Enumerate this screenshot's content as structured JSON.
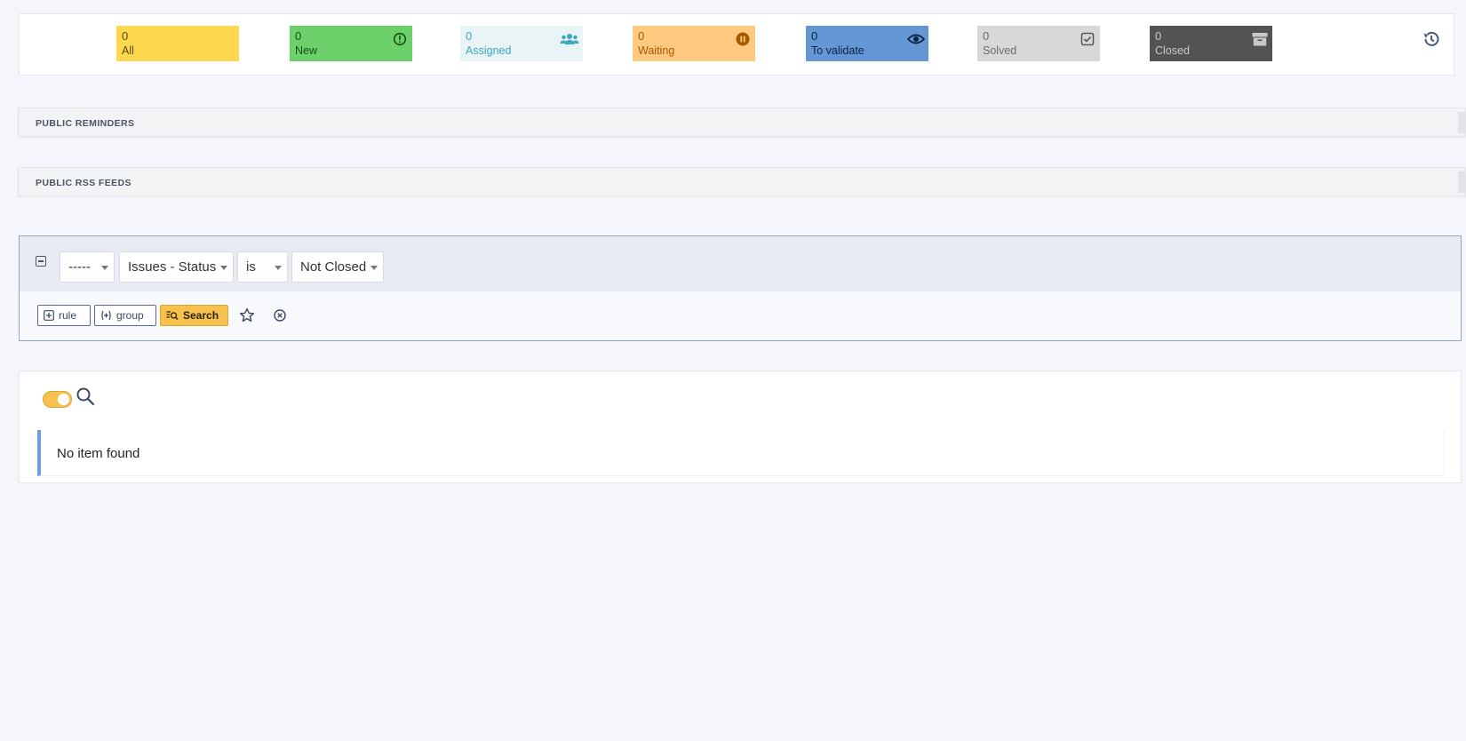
{
  "status_tiles": [
    {
      "key": "all",
      "count": "0",
      "label": "All",
      "icon": "none"
    },
    {
      "key": "new",
      "count": "0",
      "label": "New",
      "icon": "exclamation-circle-icon"
    },
    {
      "key": "assigned",
      "count": "0",
      "label": "Assigned",
      "icon": "users-icon"
    },
    {
      "key": "waiting",
      "count": "0",
      "label": "Waiting",
      "icon": "pause-circle-icon"
    },
    {
      "key": "validate",
      "count": "0",
      "label": "To validate",
      "icon": "eye-icon"
    },
    {
      "key": "solved",
      "count": "0",
      "label": "Solved",
      "icon": "check-square-icon"
    },
    {
      "key": "closed",
      "count": "0",
      "label": "Closed",
      "icon": "archive-icon"
    }
  ],
  "sections": {
    "reminders": "PUBLIC REMINDERS",
    "rss": "PUBLIC RSS FEEDS"
  },
  "criteria": {
    "field": "-----",
    "item": "Issues - Status",
    "operator": "is",
    "value": "Not Closed",
    "rule_label": "rule",
    "group_label": "group",
    "search_label": "Search"
  },
  "results": {
    "empty_message": "No item found"
  },
  "colors": {
    "all": "#ffd84f",
    "new": "#6cd16a",
    "assigned": "#e9f4f7",
    "waiting": "#ffc980",
    "validate": "#6497d6",
    "solved": "#d8d8d8",
    "closed": "#535353",
    "accent": "#f7c14d"
  }
}
